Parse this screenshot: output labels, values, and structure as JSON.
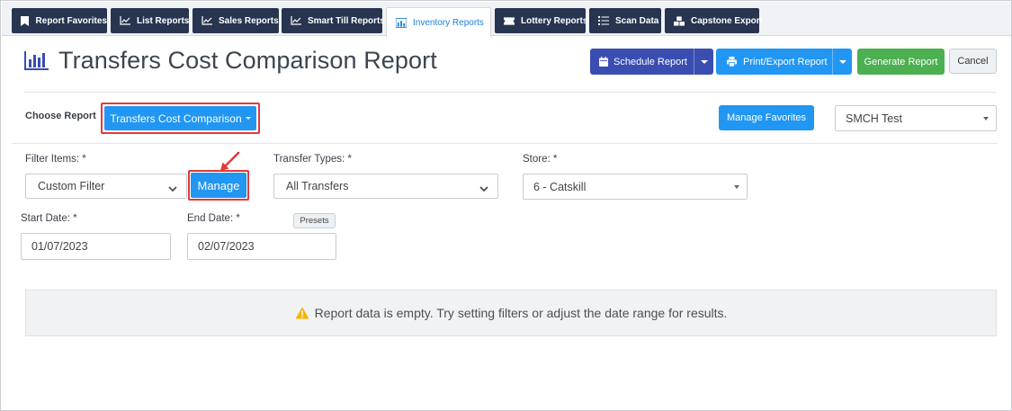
{
  "tabs": [
    {
      "label": "Report Favorites",
      "icon": "bookmark-icon"
    },
    {
      "label": "List Reports",
      "icon": "line-chart-icon"
    },
    {
      "label": "Sales Reports",
      "icon": "line-chart-icon"
    },
    {
      "label": "Smart Till Reports",
      "icon": "line-chart-icon"
    },
    {
      "label": "Inventory Reports",
      "icon": "bar-chart-icon",
      "active": true
    },
    {
      "label": "Lottery Reports",
      "icon": "ticket-icon"
    },
    {
      "label": "Scan Data",
      "icon": "list-icon"
    },
    {
      "label": "Capstone Export",
      "icon": "cubes-icon"
    }
  ],
  "header": {
    "title": "Transfers Cost Comparison Report",
    "schedule_label": "Schedule Report",
    "print_label": "Print/Export Report",
    "generate_label": "Generate Report",
    "cancel_label": "Cancel"
  },
  "choose": {
    "label": "Choose Report",
    "selected": "Transfers Cost Comparison",
    "manage_favorites": "Manage Favorites",
    "store_account": "SMCH Test"
  },
  "filters": {
    "filter_items_label": "Filter Items: *",
    "filter_items_value": "Custom Filter",
    "manage_label": "Manage",
    "transfer_types_label": "Transfer Types: *",
    "transfer_types_value": "All Transfers",
    "store_label": "Store: *",
    "store_value": "6 - Catskill",
    "start_date_label": "Start Date: *",
    "start_date_value": "01/07/2023",
    "end_date_label": "End Date: *",
    "end_date_value": "02/07/2023",
    "presets_label": "Presets"
  },
  "empty_message": "Report data is empty. Try setting filters or adjust the date range for results.",
  "colors": {
    "tab_dark": "#283550",
    "primary_blue": "#2196f3",
    "indigo": "#3a4db0",
    "green": "#4caf50",
    "highlight_red": "#e53935",
    "warning_yellow": "#f5b400"
  }
}
